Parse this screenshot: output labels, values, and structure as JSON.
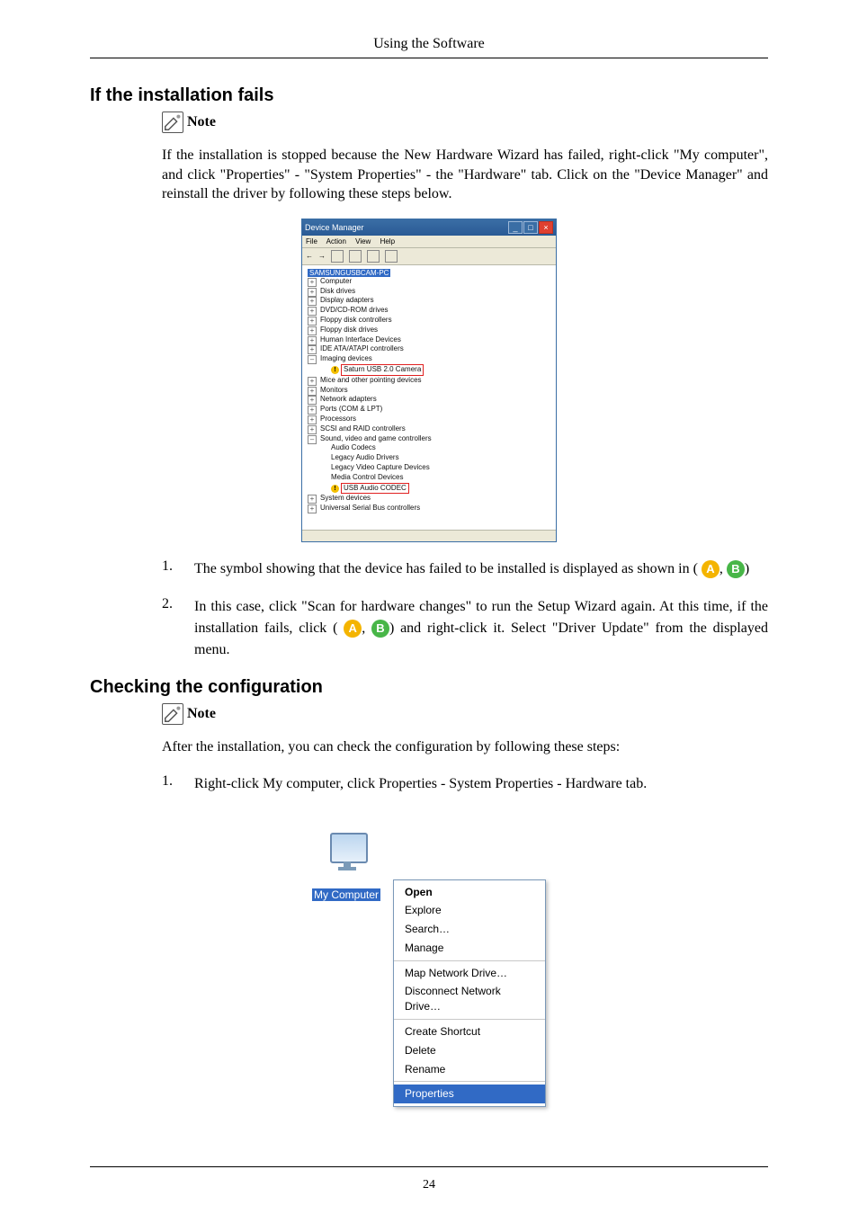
{
  "header": {
    "running": "Using the Software"
  },
  "section1": {
    "heading": "If the installation fails",
    "note_label": "Note",
    "intro": "If the installation is stopped because the New Hardware Wizard has failed, right-click \"My computer\", and click \"Properties\" - \"System Properties\" - the \"Hardware\" tab. Click on the \"Device Manager\" and reinstall the driver by following these steps below.",
    "list": {
      "n1": "1.",
      "t1a": "The symbol showing that the device has failed to be installed is displayed as shown in (",
      "t1b": ", ",
      "t1c": ")",
      "n2": "2.",
      "t2a": "In this case, click \"Scan for hardware changes\" to run the Setup Wizard again. At this time, if the installation fails, click (",
      "t2b": ", ",
      "t2c": ") and right-click it. Select \"Driver Update\" from the displayed menu."
    },
    "badge_a": "A",
    "badge_b": "B"
  },
  "devmgr": {
    "title": "Device Manager",
    "menu": {
      "file": "File",
      "action": "Action",
      "view": "View",
      "help": "Help"
    },
    "root": "SAMSUNGUSBCAM-PC",
    "nodes": {
      "computer": "Computer",
      "disk": "Disk drives",
      "display": "Display adapters",
      "dvd": "DVD/CD-ROM drives",
      "floppyc": "Floppy disk controllers",
      "floppyd": "Floppy disk drives",
      "hid": "Human Interface Devices",
      "ide": "IDE ATA/ATAPI controllers",
      "imaging": "Imaging devices",
      "imaging_item": "Saturn USB 2.0 Camera",
      "mice": "Mice and other pointing devices",
      "monitors": "Monitors",
      "network": "Network adapters",
      "ports": "Ports (COM & LPT)",
      "processors": "Processors",
      "scsi": "SCSI and RAID controllers",
      "svg": "Sound, video and game controllers",
      "svg_a": "Audio Codecs",
      "svg_b": "Legacy Audio Drivers",
      "svg_c": "Legacy Video Capture Devices",
      "svg_d": "Media Control Devices",
      "svg_e": "USB Audio CODEC",
      "system": "System devices",
      "usb": "Universal Serial Bus controllers"
    }
  },
  "section2": {
    "heading": "Checking the configuration",
    "note_label": "Note",
    "intro": "After the installation, you can check the configuration by following these steps:",
    "n1": "1.",
    "t1": "Right-click My computer, click Properties - System Properties - Hardware tab."
  },
  "context_menu": {
    "label": "My Computer",
    "items": {
      "open": "Open",
      "explore": "Explore",
      "search": "Search…",
      "manage": "Manage",
      "map": "Map Network Drive…",
      "disc": "Disconnect Network Drive…",
      "shortcut": "Create Shortcut",
      "delete": "Delete",
      "rename": "Rename",
      "props": "Properties"
    }
  },
  "footer": {
    "page": "24"
  }
}
